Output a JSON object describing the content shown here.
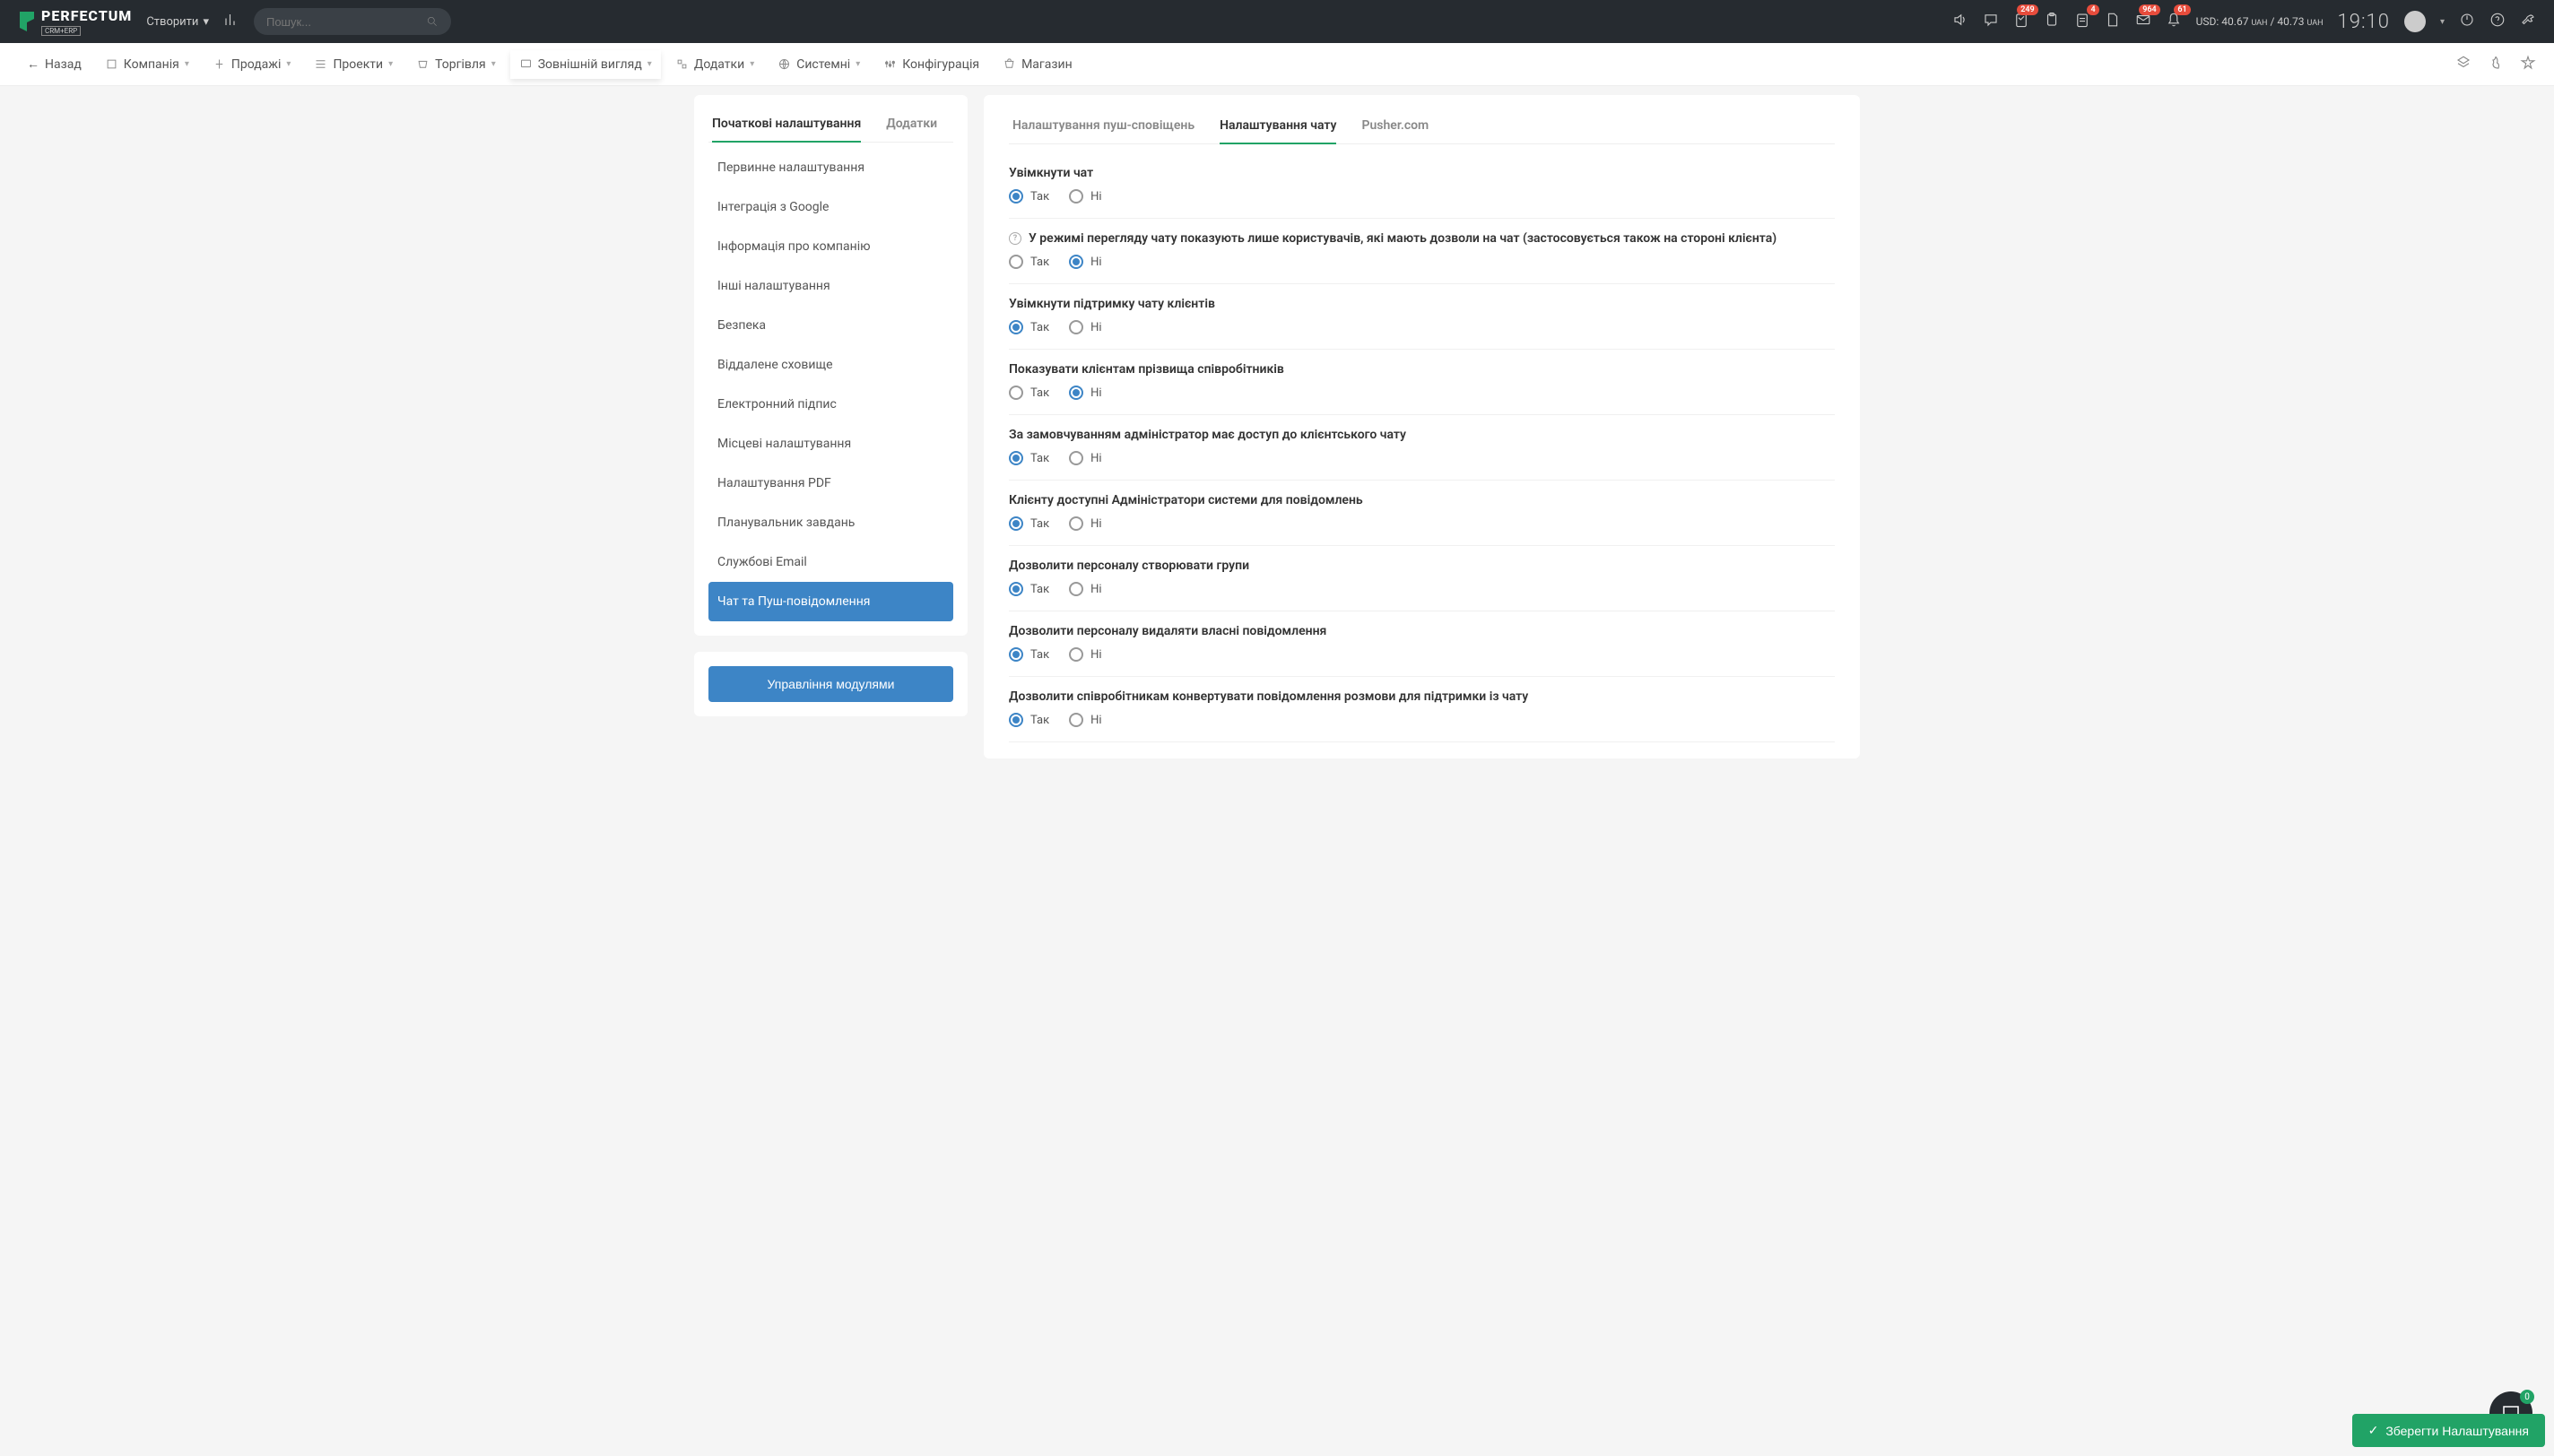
{
  "header": {
    "logo": "PERFECTUM",
    "logo_sub": "CRM+ERP",
    "create_label": "Створити",
    "search_placeholder": "Пошук...",
    "badges": {
      "b1": "249",
      "b2": "4",
      "b3": "964",
      "b4": "61"
    },
    "currency1": "USD: 40.67",
    "currency1u": "UAH",
    "currency_sep": " / ",
    "currency2": "40.73",
    "currency2u": "UAH",
    "time": "19:10",
    "fab_count": "0"
  },
  "subnav": {
    "back": "Назад",
    "items": [
      "Компанія",
      "Продажі",
      "Проекти",
      "Торгівля",
      "Зовнішній вигляд",
      "Додатки",
      "Системні",
      "Конфігурація",
      "Магазин"
    ]
  },
  "sidebar": {
    "tabs": [
      "Початкові налаштування",
      "Додатки"
    ],
    "active_tab": 0,
    "items": [
      "Первинне налаштування",
      "Інтеграція з Google",
      "Інформація про компанію",
      "Інші налаштування",
      "Безпека",
      "Віддалене сховище",
      "Електронний підпис",
      "Місцеві налаштування",
      "Налаштування PDF",
      "Планувальник завдань",
      "Службові Email",
      "Чат та Пуш-повідомлення"
    ],
    "active_index": 11,
    "module_btn": "Управління модулями"
  },
  "main": {
    "tabs": [
      "Налаштування пуш-сповіщень",
      "Налаштування чату",
      "Pusher.com"
    ],
    "active_tab": 1,
    "yes": "Так",
    "no": "Ні",
    "fields": [
      {
        "label": "Увімкнути чат",
        "value": "yes",
        "help": false
      },
      {
        "label": "У режимі перегляду чату показують лише користувачів, які мають дозволи на чат (застосовується також на стороні клієнта)",
        "value": "no",
        "help": true
      },
      {
        "label": "Увімкнути підтримку чату клієнтів",
        "value": "yes",
        "help": false
      },
      {
        "label": "Показувати клієнтам прізвища співробітників",
        "value": "no",
        "help": false
      },
      {
        "label": "За замовчуванням адміністратор має доступ до клієнтського чату",
        "value": "yes",
        "help": false
      },
      {
        "label": "Клієнту доступні Адміністратори системи для повідомлень",
        "value": "yes",
        "help": false
      },
      {
        "label": "Дозволити персоналу створювати групи",
        "value": "yes",
        "help": false
      },
      {
        "label": "Дозволити персоналу видаляти власні повідомлення",
        "value": "yes",
        "help": false
      },
      {
        "label": "Дозволити співробітникам конвертувати повідомлення розмови для підтримки із чату",
        "value": "yes",
        "help": false
      }
    ]
  },
  "save_label": "Зберегти Налаштування"
}
